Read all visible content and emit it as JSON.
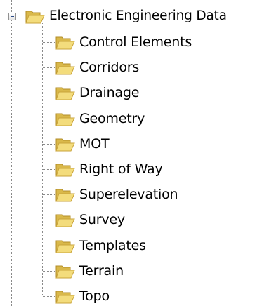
{
  "tree": {
    "root": {
      "label": "Electronic Engineering Data",
      "expanded": true,
      "icon": "open-folder-icon"
    },
    "children": [
      {
        "label": "Control Elements",
        "icon": "open-folder-icon"
      },
      {
        "label": "Corridors",
        "icon": "open-folder-icon"
      },
      {
        "label": "Drainage",
        "icon": "open-folder-icon"
      },
      {
        "label": "Geometry",
        "icon": "open-folder-icon"
      },
      {
        "label": "MOT",
        "icon": "open-folder-icon"
      },
      {
        "label": "Right of Way",
        "icon": "open-folder-icon"
      },
      {
        "label": "Superelevation",
        "icon": "open-folder-icon"
      },
      {
        "label": "Survey",
        "icon": "open-folder-icon"
      },
      {
        "label": "Templates",
        "icon": "open-folder-icon"
      },
      {
        "label": "Terrain",
        "icon": "open-folder-icon"
      },
      {
        "label": "Topo",
        "icon": "open-folder-icon"
      }
    ]
  },
  "colors": {
    "folder_back": "#d9b84a",
    "folder_front": "#f3dc7c",
    "connector": "#8a8a8a"
  }
}
